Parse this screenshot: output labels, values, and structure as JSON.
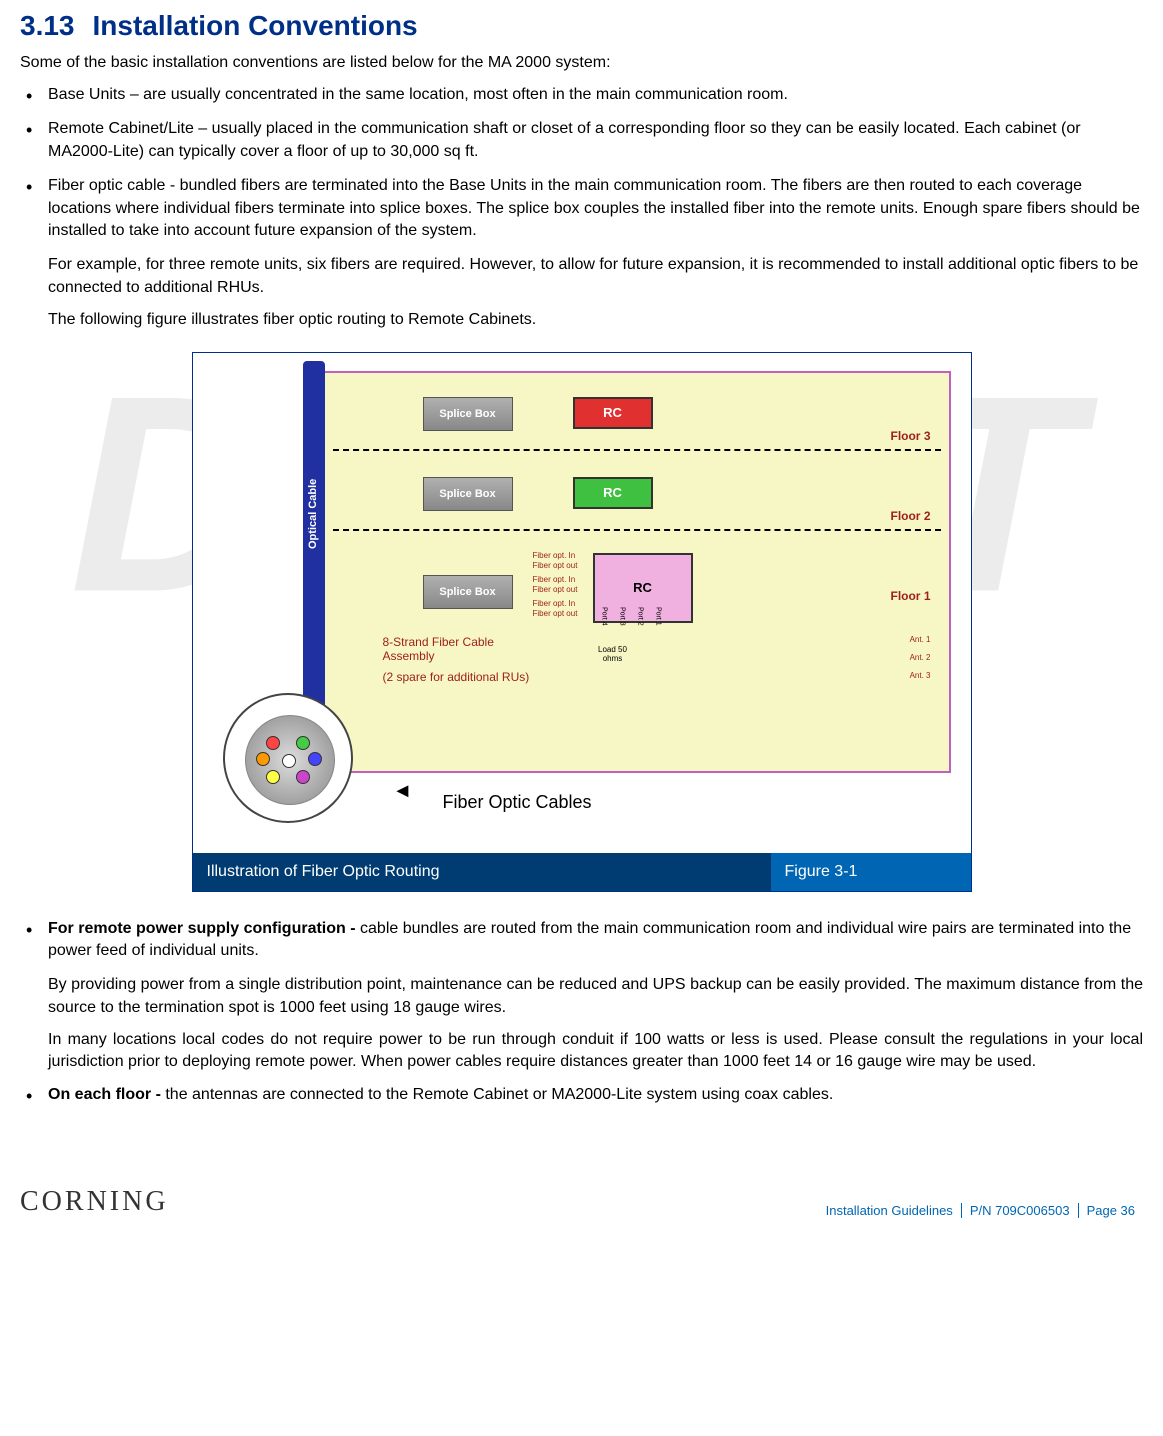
{
  "watermark": "DRAFT",
  "heading": {
    "num": "3.13",
    "title": "Installation Conventions"
  },
  "intro": "Some of the basic installation conventions are listed below for the MA 2000 system:",
  "bullets": [
    "Base Units – are usually concentrated in the same location, most often in the main communication room.",
    "Remote Cabinet/Lite – usually placed in the communication shaft or closet of a corresponding floor so they can be easily located.  Each cabinet (or MA2000-Lite) can typically cover a floor of up to 30,000 sq ft.",
    "Fiber optic cable - bundled fibers are terminated into the Base Units in the main communication room.  The fibers are then routed to each coverage locations where individual fibers terminate into splice boxes. The splice box couples the installed fiber into the remote units.  Enough spare fibers should be installed to take into account future expansion of the system."
  ],
  "subparas_fiber": [
    "For example, for three remote units, six fibers are required. However, to allow for future expansion, it is recommended to install additional optic fibers to be connected to additional RHUs.",
    "The following figure illustrates fiber optic routing to Remote Cabinets."
  ],
  "diagram": {
    "optical_cable": "Optical Cable",
    "splice_box": "Splice Box",
    "rc": "RC",
    "floor3": "Floor 3",
    "floor2": "Floor 2",
    "floor1": "Floor 1",
    "strand_label": "8-Strand Fiber Cable Assembly",
    "spare_label": "(2 spare for additional RUs)",
    "fiber_optic_cables": "Fiber Optic Cables",
    "fiber_in": "Fiber opt. In",
    "fiber_out": "Fiber opt out",
    "port4": "Port 4",
    "port3": "Port 3",
    "port2": "Port 2",
    "port1": "Port 1",
    "load": "Load 50 ohms",
    "ant1": "Ant. 1",
    "ant2": "Ant. 2",
    "ant3": "Ant. 3"
  },
  "figure": {
    "caption": "Illustration of Fiber Optic Routing",
    "num": "Figure 3-1"
  },
  "bullets2": [
    {
      "bold": "For remote power supply configuration - ",
      "text": "cable bundles are routed from the main communication room and individual wire pairs are terminated into the power feed of individual units."
    }
  ],
  "subparas_power": [
    "By providing power from a single distribution point, maintenance can be reduced and UPS backup can be easily provided. The maximum distance from the source to the termination spot is 1000 feet using 18 gauge wires.",
    "In many locations local codes do not require power to be run through conduit if 100 watts or less is used.  Please consult the regulations in your local jurisdiction prior to deploying remote power.  When power cables require distances greater than 1000 feet 14 or 16 gauge wire may be used."
  ],
  "bullets3": [
    {
      "bold": "On each floor - ",
      "text": "the antennas are connected to the Remote Cabinet or MA2000-Lite system using coax cables."
    }
  ],
  "footer": {
    "logo": "CORNING",
    "guidelines": "Installation Guidelines",
    "pn": "P/N 709C006503",
    "page": "Page 36"
  }
}
